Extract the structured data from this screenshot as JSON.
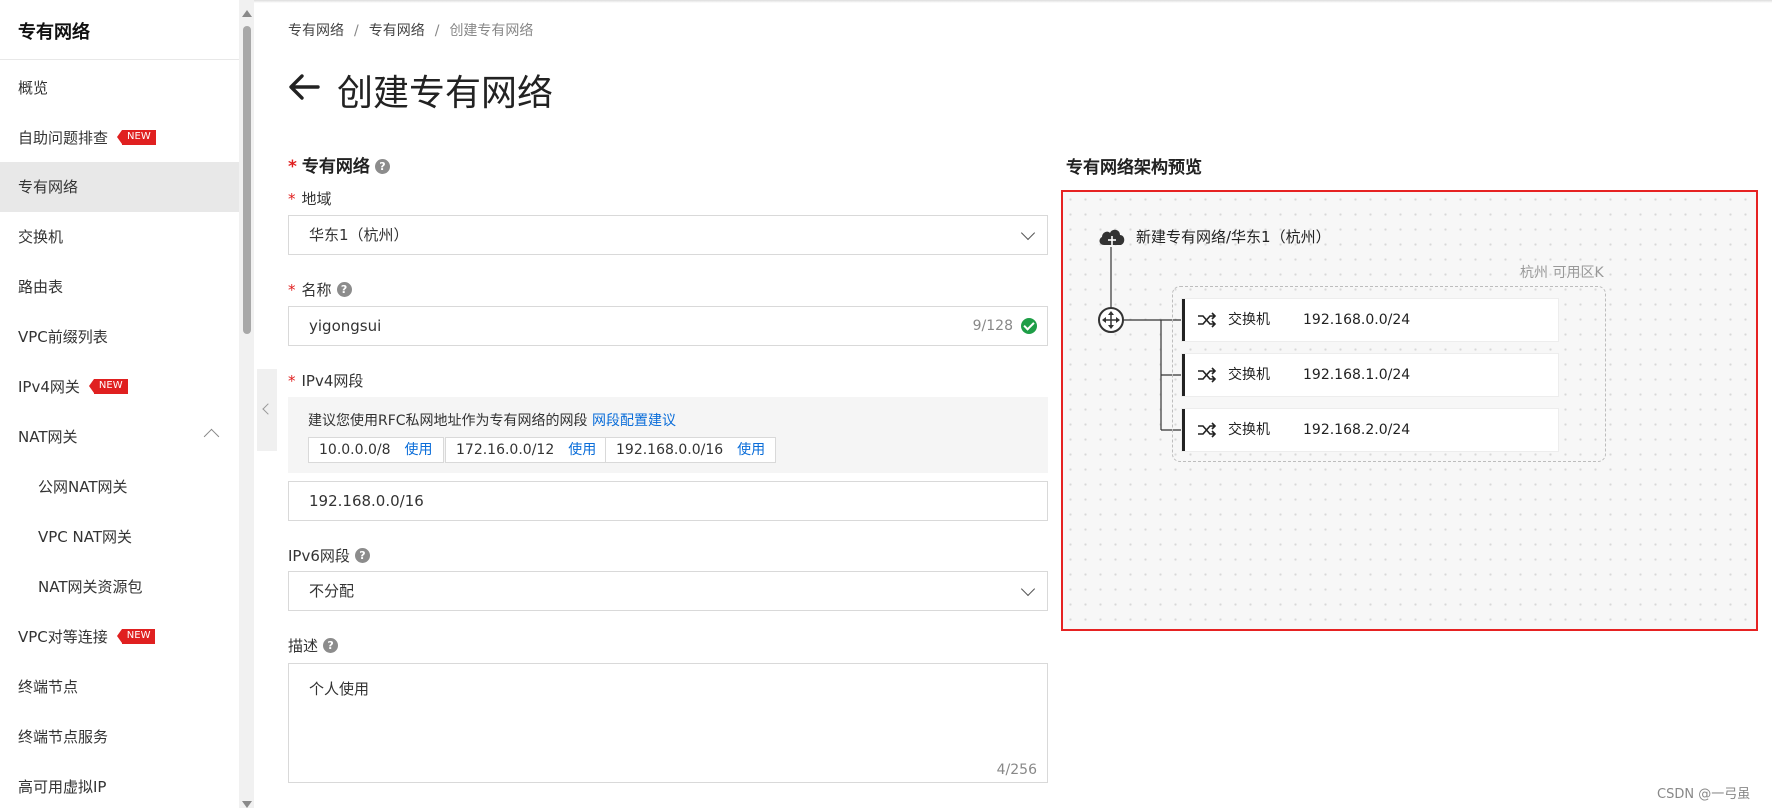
{
  "sidebar": {
    "title": "专有网络",
    "items": [
      {
        "label": "概览"
      },
      {
        "label": "自助问题排查",
        "badge": "NEW"
      },
      {
        "label": "专有网络"
      },
      {
        "label": "交换机"
      },
      {
        "label": "路由表"
      },
      {
        "label": "VPC前缀列表"
      },
      {
        "label": "IPv4网关",
        "badge": "NEW"
      },
      {
        "label": "NAT网关"
      },
      {
        "label": "公网NAT网关"
      },
      {
        "label": "VPC NAT网关"
      },
      {
        "label": "NAT网关资源包"
      },
      {
        "label": "VPC对等连接",
        "badge": "NEW"
      },
      {
        "label": "终端节点"
      },
      {
        "label": "终端节点服务"
      },
      {
        "label": "高可用虚拟IP"
      }
    ]
  },
  "breadcrumb": [
    "专有网络",
    "专有网络",
    "创建专有网络"
  ],
  "page_title": "创建专有网络",
  "form": {
    "section_title": "专有网络",
    "region": {
      "label": "地域",
      "value": "华东1（杭州）"
    },
    "name": {
      "label": "名称",
      "value": "yigongsui",
      "counter": "9/128"
    },
    "ipv4": {
      "label": "IPv4网段",
      "hint": "建议您使用RFC私网地址作为专有网络的网段",
      "hint_link": "网段配置建议",
      "options": [
        {
          "cidr": "10.0.0.0/8",
          "action": "使用"
        },
        {
          "cidr": "172.16.0.0/12",
          "action": "使用"
        },
        {
          "cidr": "192.168.0.0/16",
          "action": "使用"
        }
      ],
      "value": "192.168.0.0/16"
    },
    "ipv6": {
      "label": "IPv6网段",
      "value": "不分配"
    },
    "description": {
      "label": "描述",
      "value": "个人使用",
      "counter": "4/256"
    }
  },
  "preview": {
    "title": "专有网络架构预览",
    "vpc_label": "新建专有网络/华东1（杭州）",
    "zone_label": "杭州 可用区K",
    "switches": [
      {
        "name": "交换机",
        "cidr": "192.168.0.0/24"
      },
      {
        "name": "交换机",
        "cidr": "192.168.1.0/24"
      },
      {
        "name": "交换机",
        "cidr": "192.168.2.0/24"
      }
    ]
  },
  "watermark": "CSDN @一弓虽",
  "colors": {
    "required": "#e02020",
    "link": "#0a6dd9",
    "highlight_border": "#e62222",
    "success": "#1e9e47"
  },
  "icons": [
    "back-arrow-icon",
    "help-icon",
    "chevron-down-icon",
    "chevron-up-icon",
    "check-circle-icon",
    "cloud-icon",
    "router-icon",
    "switch-icon"
  ]
}
